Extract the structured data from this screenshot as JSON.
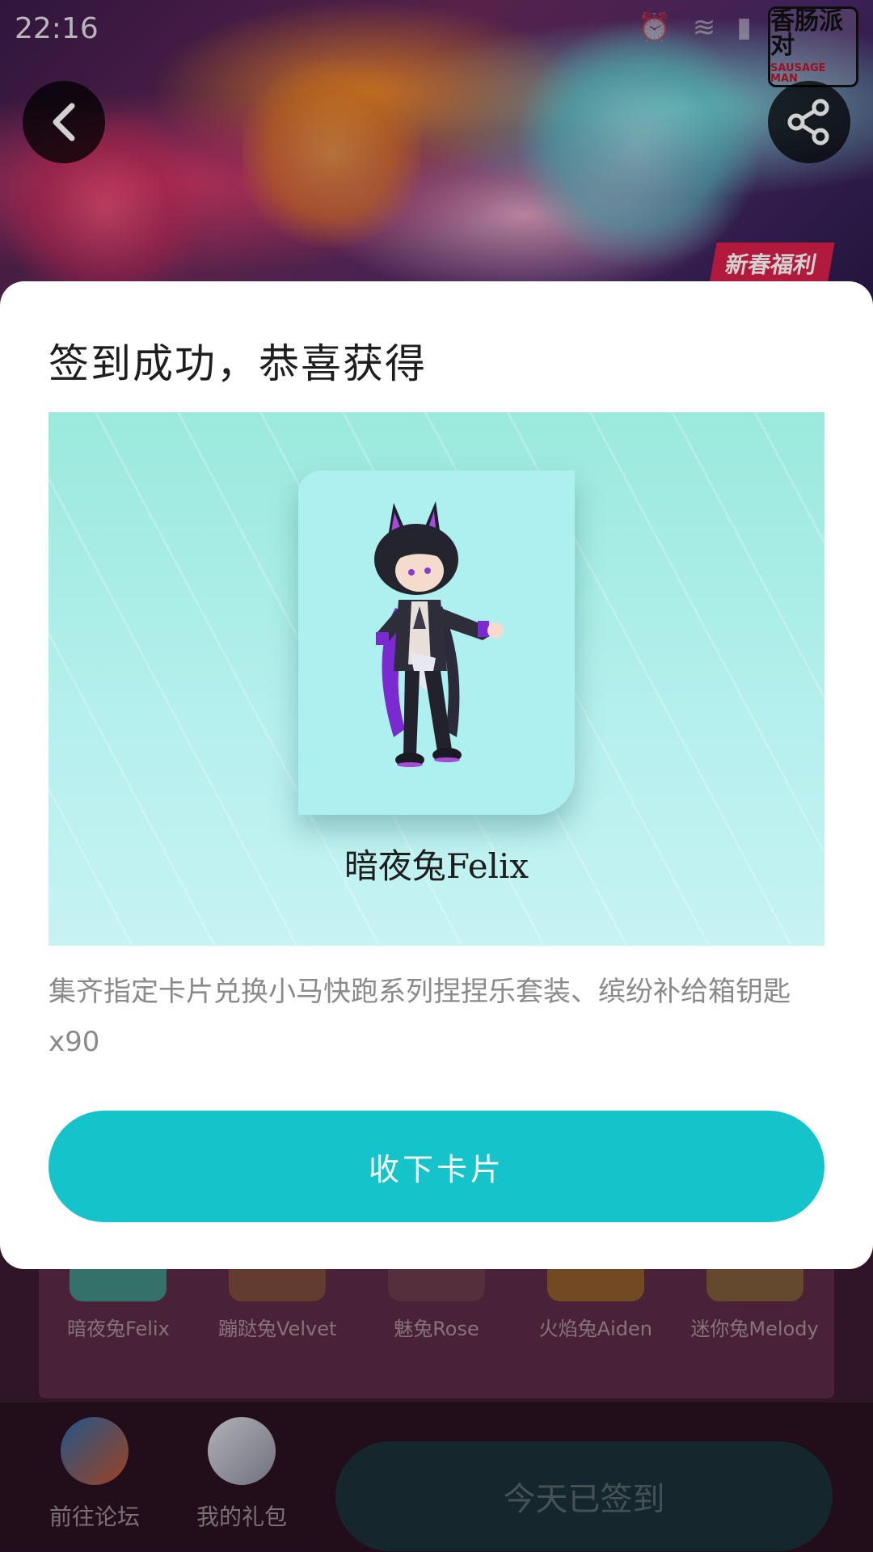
{
  "status_bar": {
    "time": "22:16",
    "icons": [
      "alarm-icon",
      "wifi-icon",
      "signal-icon",
      "battery-icon"
    ]
  },
  "banner": {
    "logo_text": "香肠派对",
    "logo_sub": "SAUSAGE MAN",
    "promo_tag": "新春福利"
  },
  "modal": {
    "title": "签到成功，恭喜获得",
    "reward_name": "暗夜兔Felix",
    "description": "集齐指定卡片兑换小马快跑系列捏捏乐套装、缤纷补给箱钥匙x90",
    "accept_label": "收下卡片"
  },
  "background_cards": [
    {
      "label": "暗夜兔Felix",
      "color": "#3f8a82"
    },
    {
      "label": "蹦跶兔Velvet",
      "color": "#7a4a3a"
    },
    {
      "label": "魅兔Rose",
      "color": "#6a3a4a"
    },
    {
      "label": "火焰兔Aiden",
      "color": "#8a5a2a"
    },
    {
      "label": "迷你兔Melody",
      "color": "#7a5a3a"
    }
  ],
  "bottom_bar": {
    "forum_label": "前往论坛",
    "gift_label": "我的礼包",
    "checkin_label": "今天已签到"
  },
  "colors": {
    "accent": "#15c3cb",
    "modal_bg": "#ffffff",
    "title_text": "#1e1e1e",
    "desc_text": "#8a8a8a"
  }
}
